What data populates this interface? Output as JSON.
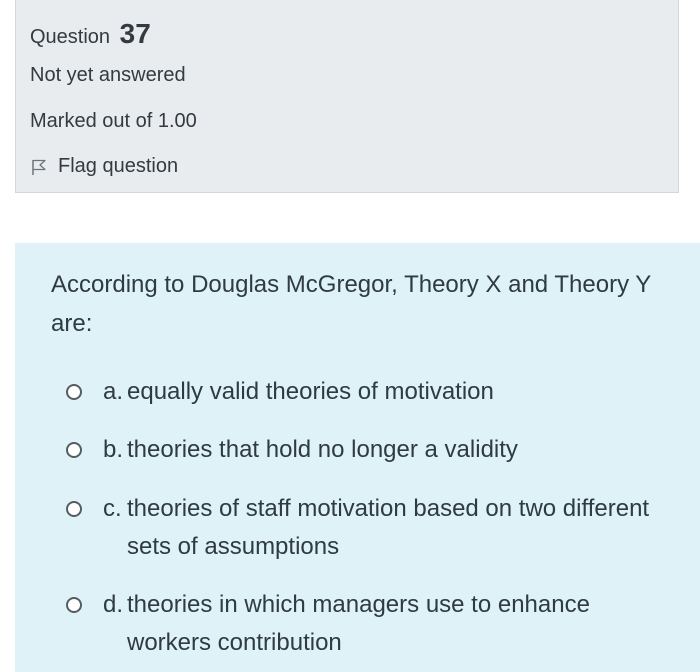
{
  "info": {
    "question_label": "Question",
    "question_number": "37",
    "state": "Not yet answered",
    "grade": "Marked out of 1.00",
    "flag_label": "Flag question"
  },
  "question": {
    "text": "According to Douglas McGregor, Theory X and Theory Y are:",
    "options": [
      {
        "letter": "a.",
        "text": "equally valid theories of motivation"
      },
      {
        "letter": "b.",
        "text": "theories that hold no longer a validity"
      },
      {
        "letter": "c.",
        "text": "theories of staff motivation based on two different sets of assumptions"
      },
      {
        "letter": "d.",
        "text": "theories in which managers use to enhance workers contribution"
      }
    ]
  },
  "colors": {
    "info_bg": "#e9ecef",
    "content_bg": "#def2f8",
    "text": "#343a40"
  }
}
